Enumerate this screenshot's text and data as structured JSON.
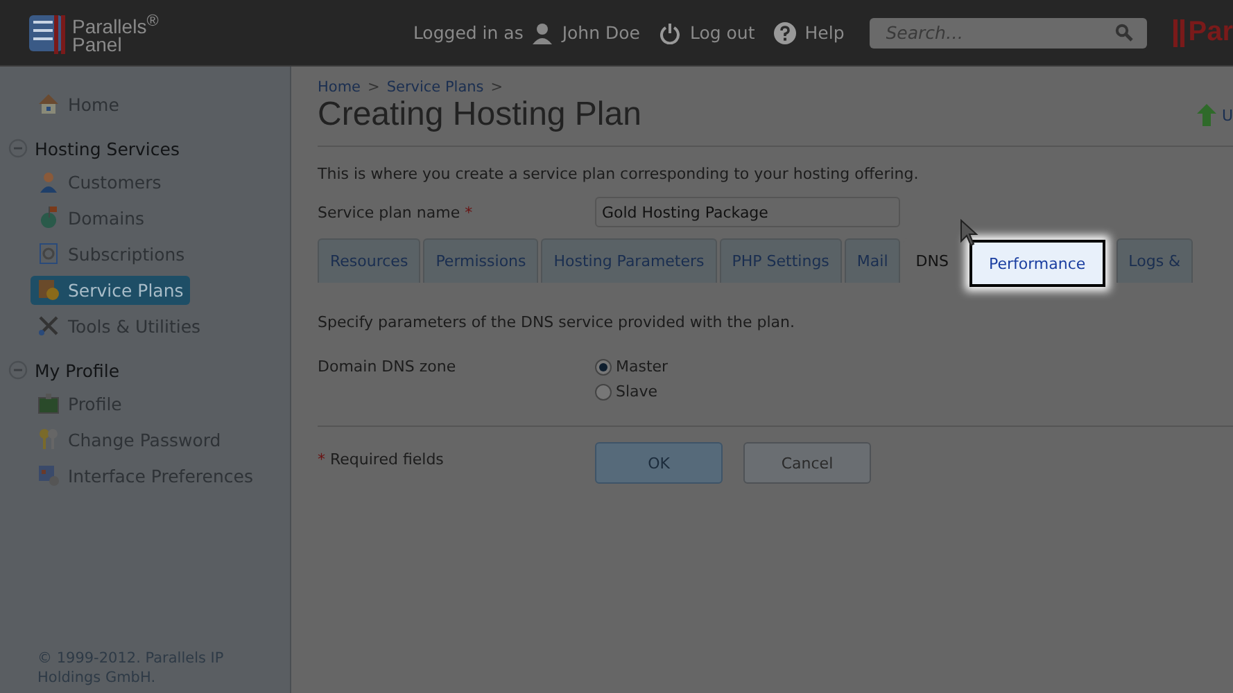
{
  "header": {
    "logo_line1": "Parallels$^{®}$",
    "logo_line2": "Panel",
    "logged_in_label": "Logged in as",
    "user_name": "John Doe",
    "logout": "Log out",
    "help": "Help",
    "search": {
      "placeholder": "Search…"
    },
    "brand_cut": "Par"
  },
  "sidebar": {
    "home": "Home",
    "sections": [
      {
        "title": "Hosting Services",
        "expanded": true,
        "items": [
          {
            "label": "Customers",
            "selected": false
          },
          {
            "label": "Domains",
            "selected": false
          },
          {
            "label": "Subscriptions",
            "selected": false
          },
          {
            "label": "Service Plans",
            "selected": true
          },
          {
            "label": "Tools & Utilities",
            "selected": false
          }
        ]
      },
      {
        "title": "My Profile",
        "expanded": true,
        "items": [
          {
            "label": "Profile",
            "selected": false
          },
          {
            "label": "Change Password",
            "selected": false
          },
          {
            "label": "Interface Preferences",
            "selected": false
          }
        ]
      }
    ],
    "copyright": "© 1999-2012. Parallels IP Holdings GmbH."
  },
  "main": {
    "breadcrumbs": [
      {
        "label": "Home",
        "separator": ">"
      },
      {
        "label": "Service Plans",
        "separator": ">"
      }
    ],
    "title": "Creating Hosting Plan",
    "side_link": "U",
    "intro": "This is where you create a service plan corresponding to your hosting offering.",
    "plan_name": {
      "label": "Service plan name",
      "required_mark": "*",
      "value": "Gold Hosting Package"
    },
    "tabs": [
      {
        "label": "Resources",
        "selected": false,
        "highlighted": false
      },
      {
        "label": "Permissions",
        "selected": false,
        "highlighted": false
      },
      {
        "label": "Hosting Parameters",
        "selected": false,
        "highlighted": false
      },
      {
        "label": "PHP Settings",
        "selected": false,
        "highlighted": false
      },
      {
        "label": "Mail",
        "selected": false,
        "highlighted": false
      },
      {
        "label": "DNS",
        "selected": true,
        "highlighted": false
      },
      {
        "label": "Performance",
        "selected": false,
        "highlighted": true
      },
      {
        "label": "Logs &",
        "selected": false,
        "highlighted": false
      }
    ],
    "dns_intro": "Specify parameters of the DNS service provided with the plan.",
    "zone": {
      "label": "Domain DNS zone",
      "options": [
        {
          "label": "Master",
          "selected": true
        },
        {
          "label": "Slave",
          "selected": false
        }
      ]
    },
    "required_note": {
      "mark": "*",
      "text": "Required fields"
    },
    "buttons": [
      {
        "label": "OK",
        "kind": "primary"
      },
      {
        "label": "Cancel",
        "kind": "secondary"
      }
    ]
  }
}
